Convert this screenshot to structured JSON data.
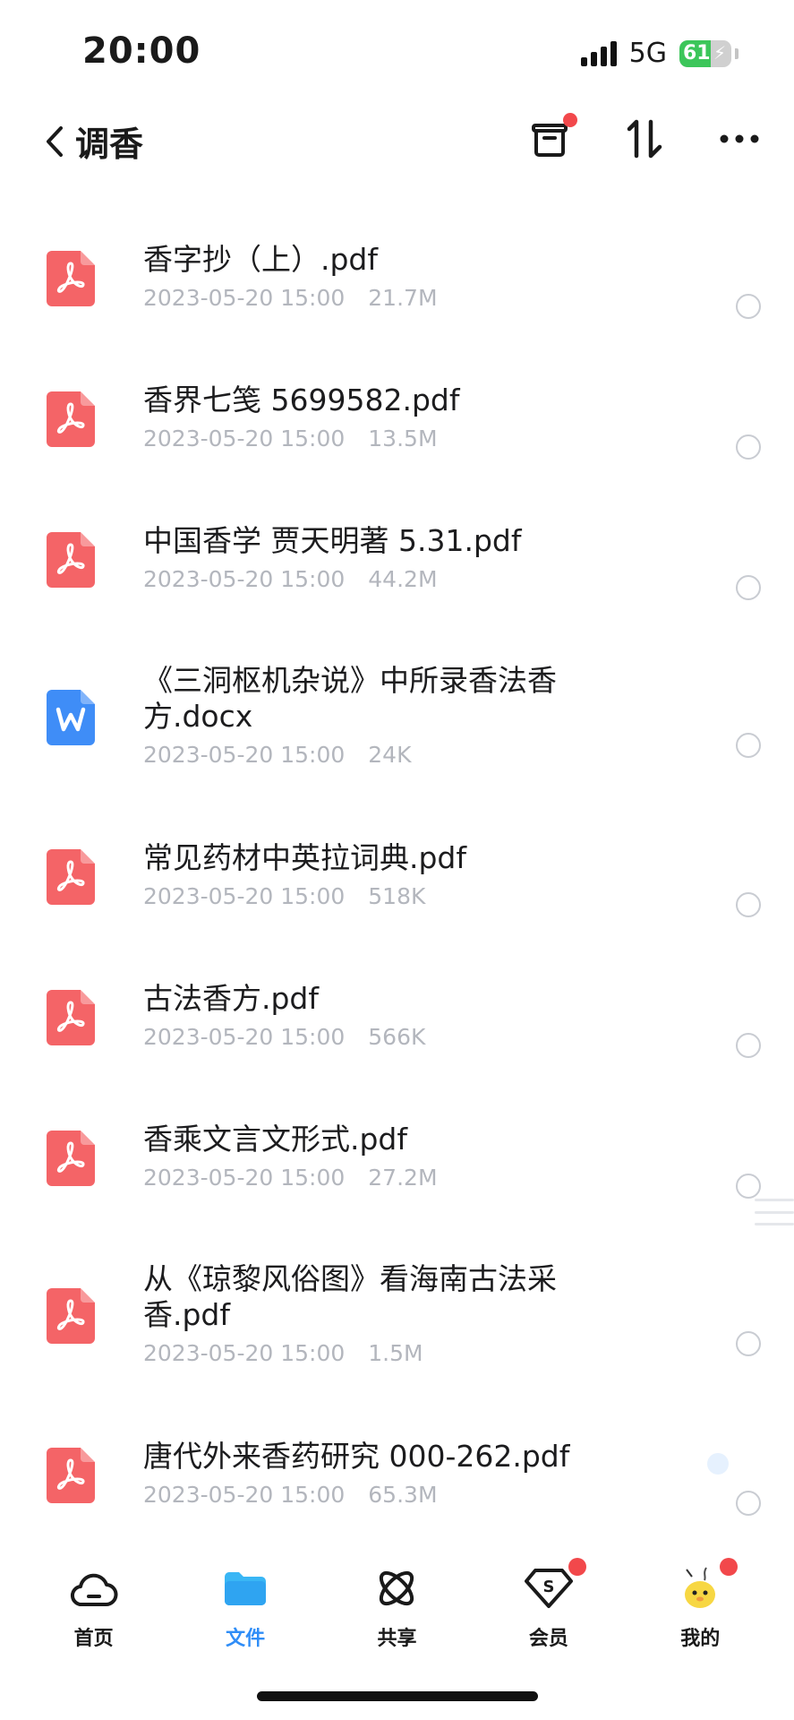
{
  "status_bar": {
    "time": "20:00",
    "network": "5G",
    "battery": "61",
    "battery_level": 61
  },
  "nav": {
    "title": "调香",
    "actions": [
      "archive-icon",
      "sort-icon",
      "more-icon"
    ]
  },
  "files": [
    {
      "name": "香字抄（上）.pdf",
      "date": "2023-05-20 15:00",
      "size": "21.7M",
      "type": "pdf"
    },
    {
      "name": "香界七笺 5699582.pdf",
      "date": "2023-05-20 15:00",
      "size": "13.5M",
      "type": "pdf"
    },
    {
      "name": "中国香学 贾天明著 5.31.pdf",
      "date": "2023-05-20 15:00",
      "size": "44.2M",
      "type": "pdf"
    },
    {
      "name": "《三洞枢机杂说》中所录香法香方.docx",
      "date": "2023-05-20 15:00",
      "size": "24K",
      "type": "docx"
    },
    {
      "name": "常见药材中英拉词典.pdf",
      "date": "2023-05-20 15:00",
      "size": "518K",
      "type": "pdf"
    },
    {
      "name": "古法香方.pdf",
      "date": "2023-05-20 15:00",
      "size": "566K",
      "type": "pdf"
    },
    {
      "name": "香乘文言文形式.pdf",
      "date": "2023-05-20 15:00",
      "size": "27.2M",
      "type": "pdf"
    },
    {
      "name": "从《琼黎风俗图》看海南古法采香.pdf",
      "date": "2023-05-20 15:00",
      "size": "1.5M",
      "type": "pdf"
    },
    {
      "name": "唐代外来香药研究 000-262.pdf",
      "date": "2023-05-20 15:00",
      "size": "65.3M",
      "type": "pdf"
    }
  ],
  "tabs": [
    {
      "label": "首页",
      "icon": "cloud-icon",
      "active": false,
      "badge": false
    },
    {
      "label": "文件",
      "icon": "folder-icon",
      "active": true,
      "badge": false
    },
    {
      "label": "共享",
      "icon": "share-icon",
      "active": false,
      "badge": false
    },
    {
      "label": "会员",
      "icon": "vip-icon",
      "active": false,
      "badge": true
    },
    {
      "label": "我的",
      "icon": "avatar-icon",
      "active": false,
      "badge": true
    }
  ],
  "colors": {
    "pdf": "#f46467",
    "docx": "#3f8df7",
    "accent": "#2f8df7",
    "badge": "#f2484b"
  }
}
